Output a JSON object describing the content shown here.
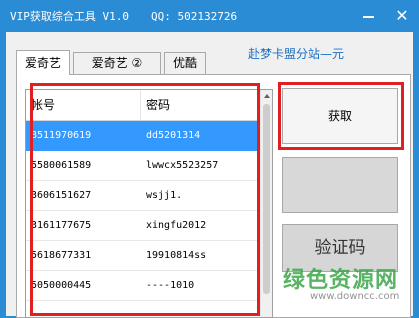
{
  "window": {
    "title": "VIP获取综合工具 V1.0",
    "qq": "QQ: 502132726",
    "minimize_symbol": "—",
    "close_symbol": "✕"
  },
  "tabs": [
    {
      "label": "爱奇艺",
      "active": true
    },
    {
      "label": "爱奇艺 ②",
      "active": false
    },
    {
      "label": "优酷",
      "active": false
    }
  ],
  "link": "赴梦卡盟分站—元",
  "table": {
    "columns": [
      "帐号",
      "密码"
    ],
    "rows": [
      {
        "account": "8511970619",
        "password": "dd5201314",
        "selected": true
      },
      {
        "account": "5580061589",
        "password": "lwwcx5523257",
        "selected": false
      },
      {
        "account": "3606151627",
        "password": "wsjj1.",
        "selected": false
      },
      {
        "account": "3161177675",
        "password": "xingfu2012",
        "selected": false
      },
      {
        "account": "5618677331",
        "password": "19910814ss",
        "selected": false
      },
      {
        "account": "5050000445",
        "password": "----1010",
        "selected": false
      }
    ]
  },
  "buttons": {
    "get": "获取",
    "blank": "",
    "verify": "验证码"
  },
  "watermark": {
    "text": "绿色资源网",
    "url": "www.downcc.com"
  },
  "colors": {
    "titlebar": "#2b8cd6",
    "selection": "#3399ff",
    "highlight_box": "#e02020",
    "link": "#1a6fc4",
    "watermark": "#3da64a"
  }
}
